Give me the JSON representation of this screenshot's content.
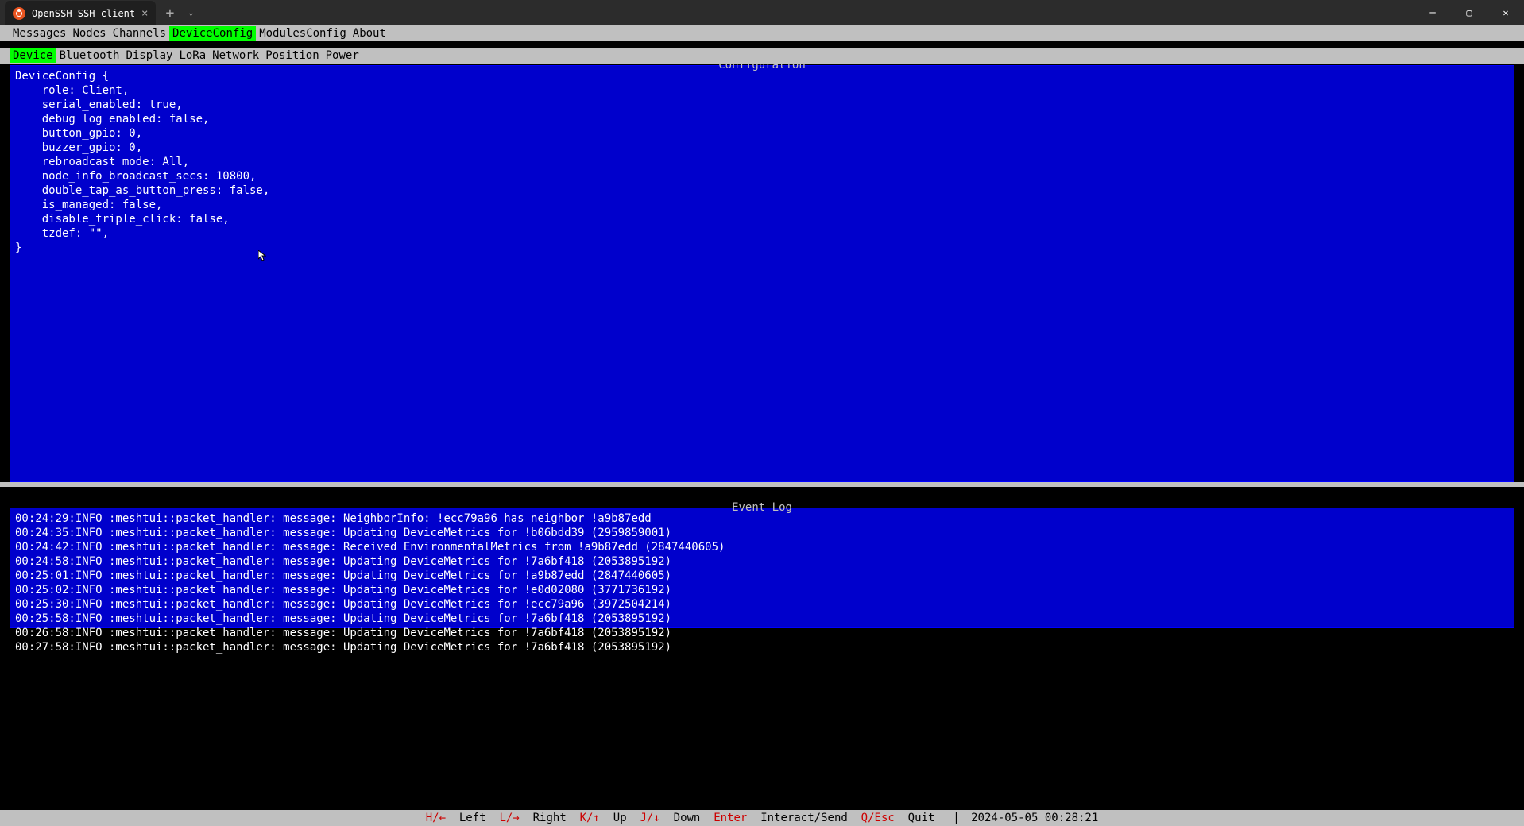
{
  "window": {
    "tab_title": "OpenSSH SSH client"
  },
  "top_menu": {
    "items": [
      "Messages",
      "Nodes",
      "Channels",
      "DeviceConfig",
      "ModulesConfig",
      "About"
    ],
    "active_index": 3
  },
  "sub_menu": {
    "items": [
      "Device",
      "Bluetooth",
      "Display",
      "LoRa",
      "Network",
      "Position",
      "Power"
    ],
    "active_index": 0
  },
  "config": {
    "title": "Configuration",
    "content": "DeviceConfig {\n    role: Client,\n    serial_enabled: true,\n    debug_log_enabled: false,\n    button_gpio: 0,\n    buzzer_gpio: 0,\n    rebroadcast_mode: All,\n    node_info_broadcast_secs: 10800,\n    double_tap_as_button_press: false,\n    is_managed: false,\n    disable_triple_click: false,\n    tzdef: \"\",\n}"
  },
  "event_log": {
    "title": "Event Log",
    "lines": [
      "00:24:29:INFO :meshtui::packet_handler: message: NeighborInfo: !ecc79a96 has neighbor !a9b87edd",
      "00:24:35:INFO :meshtui::packet_handler: message: Updating DeviceMetrics for !b06bdd39 (2959859001)",
      "00:24:42:INFO :meshtui::packet_handler: message: Received EnvironmentalMetrics from !a9b87edd (2847440605)",
      "00:24:58:INFO :meshtui::packet_handler: message: Updating DeviceMetrics for !7a6bf418 (2053895192)",
      "00:25:01:INFO :meshtui::packet_handler: message: Updating DeviceMetrics for !a9b87edd (2847440605)",
      "00:25:02:INFO :meshtui::packet_handler: message: Updating DeviceMetrics for !e0d02080 (3771736192)",
      "00:25:30:INFO :meshtui::packet_handler: message: Updating DeviceMetrics for !ecc79a96 (3972504214)",
      "00:25:58:INFO :meshtui::packet_handler: message: Updating DeviceMetrics for !7a6bf418 (2053895192)",
      "00:26:58:INFO :meshtui::packet_handler: message: Updating DeviceMetrics for !7a6bf418 (2053895192)",
      "00:27:58:INFO :meshtui::packet_handler: message: Updating DeviceMetrics for !7a6bf418 (2053895192)"
    ]
  },
  "status": {
    "keys": [
      {
        "key": "H/←",
        "label": "Left"
      },
      {
        "key": "L/→",
        "label": "Right"
      },
      {
        "key": "K/↑",
        "label": "Up"
      },
      {
        "key": "J/↓",
        "label": "Down"
      },
      {
        "key": "Enter",
        "label": "Interact/Send"
      },
      {
        "key": "Q/Esc",
        "label": "Quit"
      }
    ],
    "timestamp": "2024-05-05 00:28:21"
  }
}
